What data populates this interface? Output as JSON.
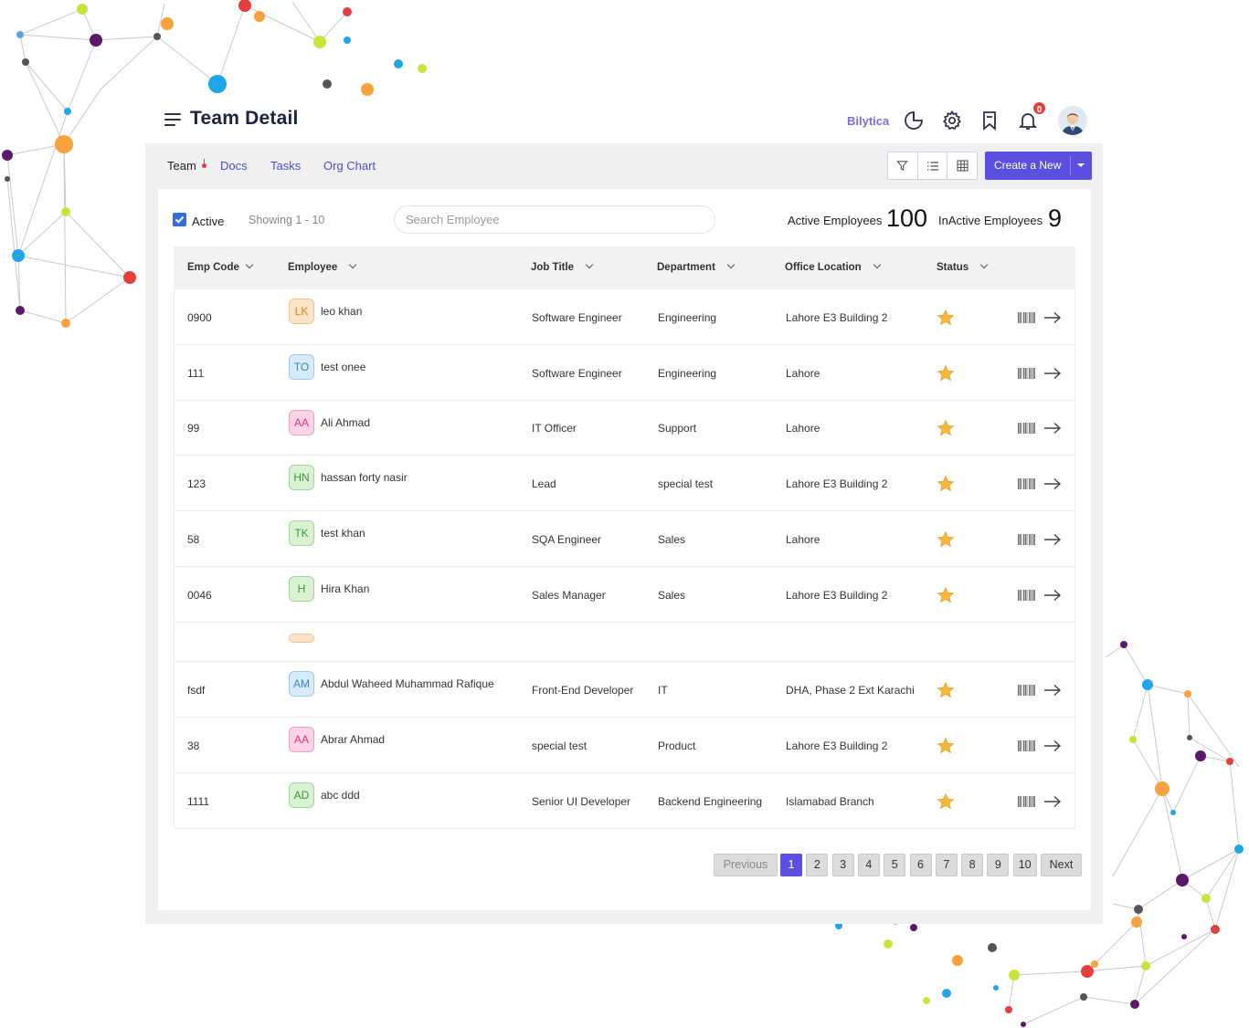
{
  "header": {
    "title": "Team Detail",
    "brand": "Bilytica",
    "notification_count": "0"
  },
  "tabs": [
    "Team",
    "Docs",
    "Tasks",
    "Org Chart"
  ],
  "toolbar": {
    "create_label": "Create a New"
  },
  "filters": {
    "active_label": "Active",
    "active_checked": true,
    "showing": "Showing 1 - 10",
    "search_placeholder": "Search Employee"
  },
  "stats": {
    "active_label": "Active Employees",
    "active_value": "100",
    "inactive_label": "InActive Employees",
    "inactive_value": "9"
  },
  "table": {
    "columns": [
      "Emp Code",
      "Employee",
      "Job Title",
      "Department",
      "Office Location",
      "Status"
    ],
    "rows": [
      {
        "code": "0900",
        "initials": "LK",
        "name": "leo khan",
        "job": "Software Engineer",
        "dept": "Engineering",
        "location": "Lahore E3 Building 2",
        "badge_color": "#fde3c8",
        "badge_text": "#d9822b"
      },
      {
        "code": "111",
        "initials": "TO",
        "name": "test onee",
        "job": "Software Engineer",
        "dept": "Engineering",
        "location": "Lahore",
        "badge_color": "#d6ebfb",
        "badge_text": "#3b86c8"
      },
      {
        "code": "99",
        "initials": "AA",
        "name": "Ali Ahmad",
        "job": "IT Officer",
        "dept": "Support",
        "location": "Lahore",
        "badge_color": "#fbd3e6",
        "badge_text": "#d23b7a"
      },
      {
        "code": "123",
        "initials": "HN",
        "name": "hassan forty nasir",
        "job": "Lead",
        "dept": "special test",
        "location": "Lahore E3 Building 2",
        "badge_color": "#d8f2d2",
        "badge_text": "#3a9b3a"
      },
      {
        "code": "58",
        "initials": "TK",
        "name": "test khan",
        "job": "SQA Engineer",
        "dept": "Sales",
        "location": "Lahore",
        "badge_color": "#d8f2d2",
        "badge_text": "#3a9b3a"
      },
      {
        "code": "0046",
        "initials": "H",
        "name": "Hira Khan",
        "job": "Sales Manager",
        "dept": "Sales",
        "location": "Lahore E3 Building 2",
        "badge_color": "#d8f2d2",
        "badge_text": "#3a9b3a"
      },
      {
        "code": "",
        "initials": "",
        "name": "",
        "job": "",
        "dept": "",
        "location": "",
        "badge_color": "#fde3c8",
        "badge_text": "#d9822b"
      },
      {
        "code": "fsdf",
        "initials": "AM",
        "name": "Abdul Waheed Muhammad Rafique",
        "job": "Front-End Developer",
        "dept": "IT",
        "location": "DHA, Phase 2 Ext Karachi",
        "badge_color": "#d6ebfb",
        "badge_text": "#3b86c8"
      },
      {
        "code": "38",
        "initials": "AA",
        "name": "Abrar Ahmad",
        "job": "special test",
        "dept": "Product",
        "location": "Lahore E3 Building 2",
        "badge_color": "#fbd3e6",
        "badge_text": "#d23b7a"
      },
      {
        "code": "1111",
        "initials": "AD",
        "name": "abc ddd",
        "job": "Senior UI Developer",
        "dept": "Backend Engineering",
        "location": "Islamabad Branch",
        "badge_color": "#d8f2d2",
        "badge_text": "#3a9b3a"
      }
    ]
  },
  "pagination": {
    "previous": "Previous",
    "next": "Next",
    "pages": [
      "1",
      "2",
      "3",
      "4",
      "5",
      "6",
      "7",
      "8",
      "9",
      "10"
    ],
    "current": "1"
  },
  "colors": {
    "accent": "#5b4fe0",
    "link": "#4a4fc9",
    "star": "#f5b83a",
    "badge": "#e53e3e"
  }
}
